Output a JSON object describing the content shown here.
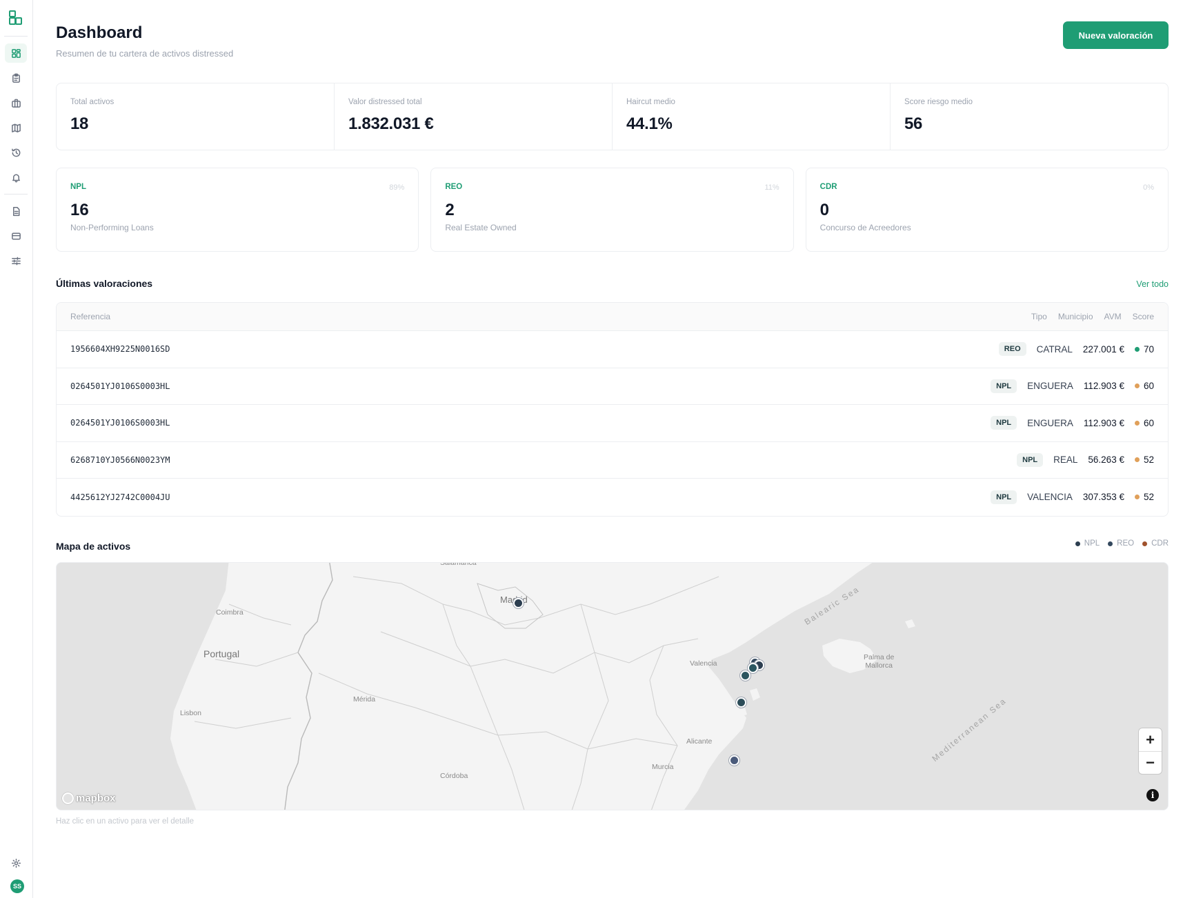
{
  "header": {
    "title": "Dashboard",
    "subtitle": "Resumen de tu cartera de activos distressed",
    "new_button": "Nueva valoración"
  },
  "kpis": [
    {
      "label": "Total activos",
      "value": "18"
    },
    {
      "label": "Valor distressed total",
      "value": "1.832.031 €"
    },
    {
      "label": "Haircut medio",
      "value": "44.1%"
    },
    {
      "label": "Score riesgo medio",
      "value": "56"
    }
  ],
  "asset_types": [
    {
      "code": "NPL",
      "percent": "89%",
      "count": "16",
      "description": "Non-Performing Loans"
    },
    {
      "code": "REO",
      "percent": "11%",
      "count": "2",
      "description": "Real Estate Owned"
    },
    {
      "code": "CDR",
      "percent": "0%",
      "count": "0",
      "description": "Concurso de Acreedores"
    }
  ],
  "valuations": {
    "title": "Últimas valoraciones",
    "see_all": "Ver todo",
    "columns": {
      "reference": "Referencia",
      "type": "Tipo",
      "municipality": "Municipio",
      "avm": "AVM",
      "score": "Score"
    },
    "rows": [
      {
        "reference": "1956604XH9225N0016SD",
        "type": "REO",
        "municipality": "CATRAL",
        "avm": "227.001 €",
        "score": "70",
        "score_color": "#1f9d74"
      },
      {
        "reference": "0264501YJ0106S0003HL",
        "type": "NPL",
        "municipality": "ENGUERA",
        "avm": "112.903 €",
        "score": "60",
        "score_color": "#e0a05a"
      },
      {
        "reference": "0264501YJ0106S0003HL",
        "type": "NPL",
        "municipality": "ENGUERA",
        "avm": "112.903 €",
        "score": "60",
        "score_color": "#e0a05a"
      },
      {
        "reference": "6268710YJ0566N0023YM",
        "type": "NPL",
        "municipality": "REAL",
        "avm": "56.263 €",
        "score": "52",
        "score_color": "#e0a05a"
      },
      {
        "reference": "4425612YJ2742C0004JU",
        "type": "NPL",
        "municipality": "VALENCIA",
        "avm": "307.353 €",
        "score": "52",
        "score_color": "#e0a05a"
      }
    ]
  },
  "map": {
    "title": "Mapa de activos",
    "legend": [
      {
        "label": "NPL",
        "color": "#2c3e50"
      },
      {
        "label": "REO",
        "color": "#34495e"
      },
      {
        "label": "CDR",
        "color": "#a0522d"
      }
    ],
    "labels": {
      "coimbra": "Coimbra",
      "portugal": "Portugal",
      "lisbon": "Lisbon",
      "merida": "Mérida",
      "cordoba": "Córdoba",
      "madrid": "Madrid",
      "valencia": "Valencia",
      "alicante": "Alicante",
      "murcia": "Murcia",
      "palma": "Palma de\nMallorca",
      "balearic_sea": "Balearic Sea",
      "mediterranean_sea": "Mediterranean Sea"
    },
    "attribution": "mapbox",
    "zoom_in": "+",
    "zoom_out": "−",
    "info": "i",
    "footer": "Haz clic en un activo para ver el detalle"
  },
  "sidebar": {
    "avatar_initials": "SS",
    "items": [
      "dashboard-icon",
      "clipboard-icon",
      "briefcase-icon",
      "map-icon",
      "history-icon",
      "bell-icon",
      "document-icon",
      "card-icon",
      "sliders-icon",
      "gear-icon"
    ]
  },
  "colors": {
    "accent": "#1f9d74"
  }
}
